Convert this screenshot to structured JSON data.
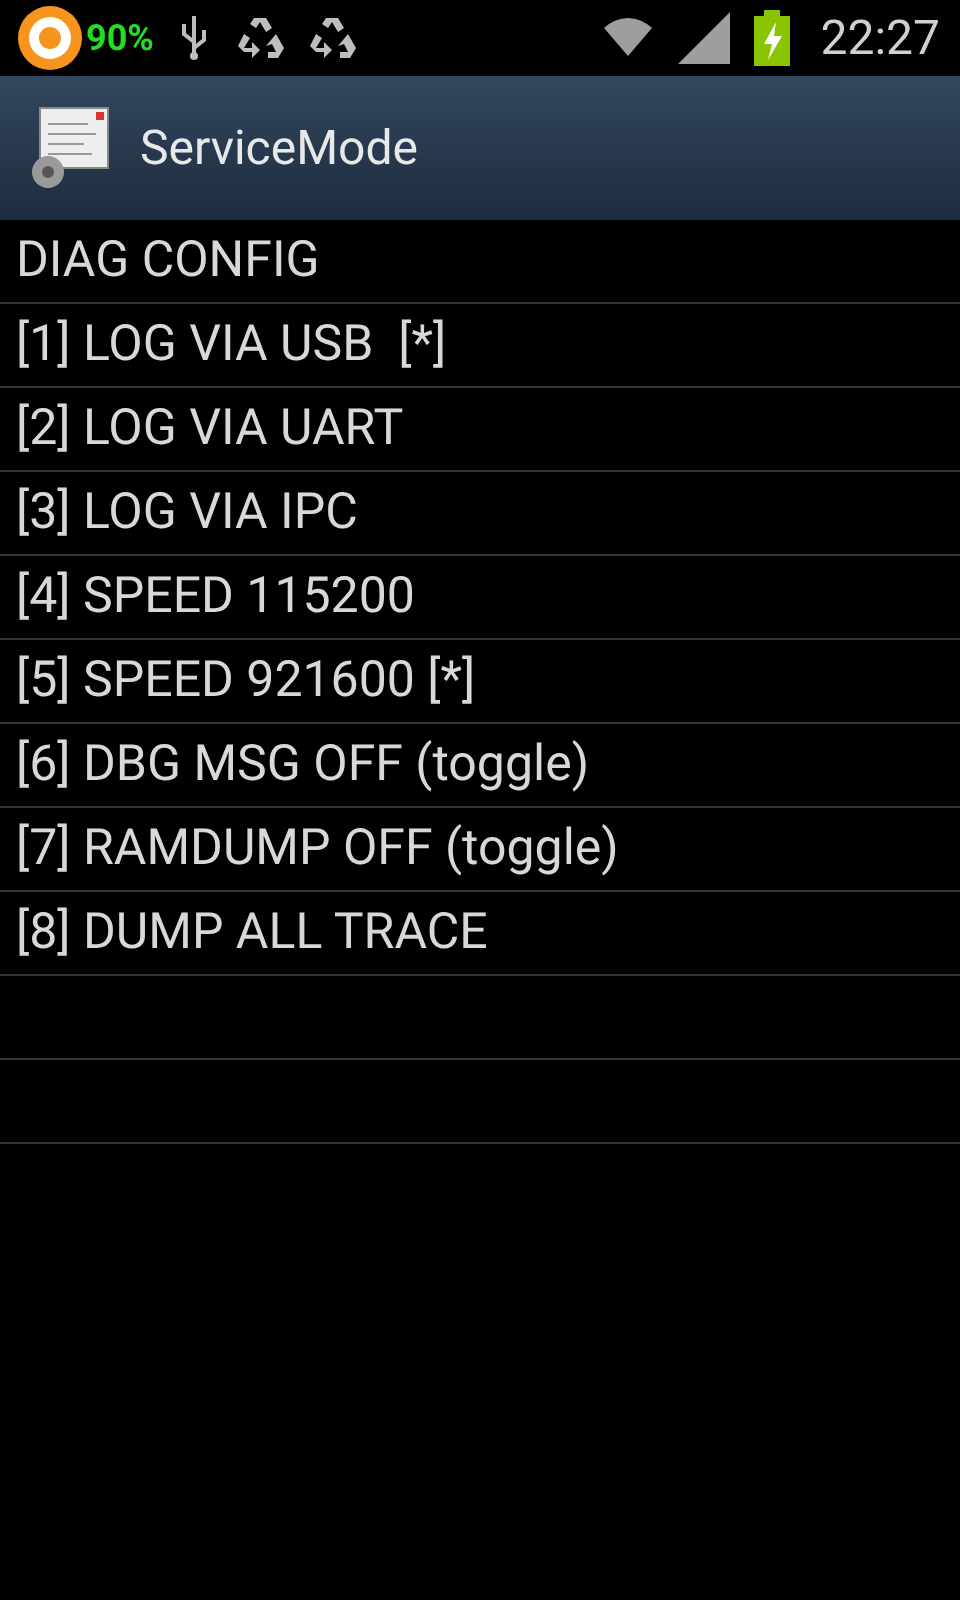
{
  "status_bar": {
    "battery_percent": "90%",
    "time": "22:27"
  },
  "app_bar": {
    "title": "ServiceMode"
  },
  "lines": [
    "DIAG CONFIG",
    "[1] LOG VIA USB  [*]",
    "[2] LOG VIA UART",
    "[3] LOG VIA IPC",
    "[4] SPEED 115200",
    "[5] SPEED 921600 [*]",
    "[6] DBG MSG OFF (toggle)",
    "[7] RAMDUMP OFF (toggle)",
    "[8] DUMP ALL TRACE"
  ]
}
